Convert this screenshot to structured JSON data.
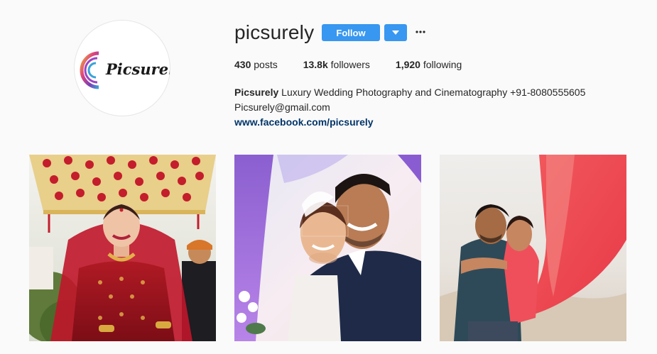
{
  "profile": {
    "username": "picsurely",
    "avatar_logo_text": "Picsurely",
    "follow_label": "Follow",
    "dropdown_icon": "chevron-down-icon",
    "more_icon": "more-options-icon"
  },
  "stats": {
    "posts_count": "430",
    "posts_label": " posts",
    "followers_count": "13.8k",
    "followers_label": " followers",
    "following_count": "1,920",
    "following_label": " following"
  },
  "bio": {
    "name": "Picsurely",
    "description": " Luxury Wedding Photography and Cinematography +91-8080555605",
    "email": "Picsurely@gmail.com",
    "link": "www.facebook.com/picsurely"
  },
  "posts": [
    {
      "kind": "photo",
      "subject": "bride in red lehenga under floral canopy"
    },
    {
      "kind": "photo",
      "subject": "smiling couple embracing, bride with veil"
    },
    {
      "kind": "photo",
      "subject": "couple embracing with flowing pink scarf"
    }
  ],
  "colors": {
    "accent": "#3897f0",
    "link": "#003569",
    "text": "#262626",
    "background": "#fafafa"
  }
}
